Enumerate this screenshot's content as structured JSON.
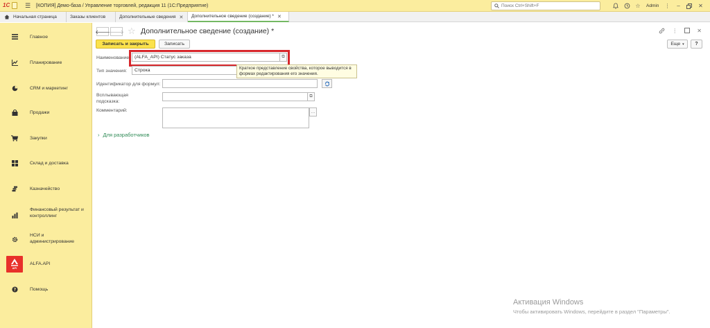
{
  "titlebar": {
    "logo": "1С",
    "title": "[КОПИЯ] Демо-база / Управление торговлей, редакция 11  (1С:Предприятие)",
    "search_placeholder": "Поиск Ctrl+Shift+F",
    "user": "Admin"
  },
  "tabs": [
    {
      "label": "Начальная страница"
    },
    {
      "label": "Заказы клиентов"
    },
    {
      "label": "Дополнительные сведения"
    },
    {
      "label": "Дополнительное сведение (создание) *"
    }
  ],
  "sidebar": {
    "items": [
      {
        "label": "Главное",
        "icon": "menu-lines-icon"
      },
      {
        "label": "Планирование",
        "icon": "chart-icon"
      },
      {
        "label": "CRM и маркетинг",
        "icon": "pie-icon"
      },
      {
        "label": "Продажи",
        "icon": "shopping-bag-icon"
      },
      {
        "label": "Закупки",
        "icon": "cart-icon"
      },
      {
        "label": "Склад и доставка",
        "icon": "grid-icon"
      },
      {
        "label": "Казначейство",
        "icon": "coins-icon"
      },
      {
        "label": "Финансовый результат и контроллинг",
        "icon": "bar-chart-icon"
      },
      {
        "label": "НСИ и администрирование",
        "icon": "gear-icon"
      },
      {
        "label": "ALFA.API",
        "icon": "alfa-logo-icon",
        "logo_text": "API"
      },
      {
        "label": "Помощь",
        "icon": "help-icon"
      }
    ]
  },
  "form": {
    "title": "Дополнительное сведение (создание) *",
    "save_close_label": "Записать и закрыть",
    "save_label": "Записать",
    "more_label": "Еще",
    "help_label": "?",
    "name_label": "Наименование:",
    "name_value": "(ALFA_API) Статус заказа",
    "type_label": "Тип значения:",
    "type_value": "Строка",
    "formula_id_label": "Идентификатор для формул:",
    "formula_id_value": "",
    "tooltip_label": "Всплывающая подсказка:",
    "tooltip_value": "",
    "comment_label": "Комментарий:",
    "comment_value": "",
    "hint_text": "Краткое представление свойства, которое выводится в формах редактирования его значения.",
    "dev_link": "Для разработчиков"
  },
  "watermark": {
    "line1": "Активация Windows",
    "line2": "Чтобы активировать Windows, перейдите в раздел \"Параметры\"."
  }
}
